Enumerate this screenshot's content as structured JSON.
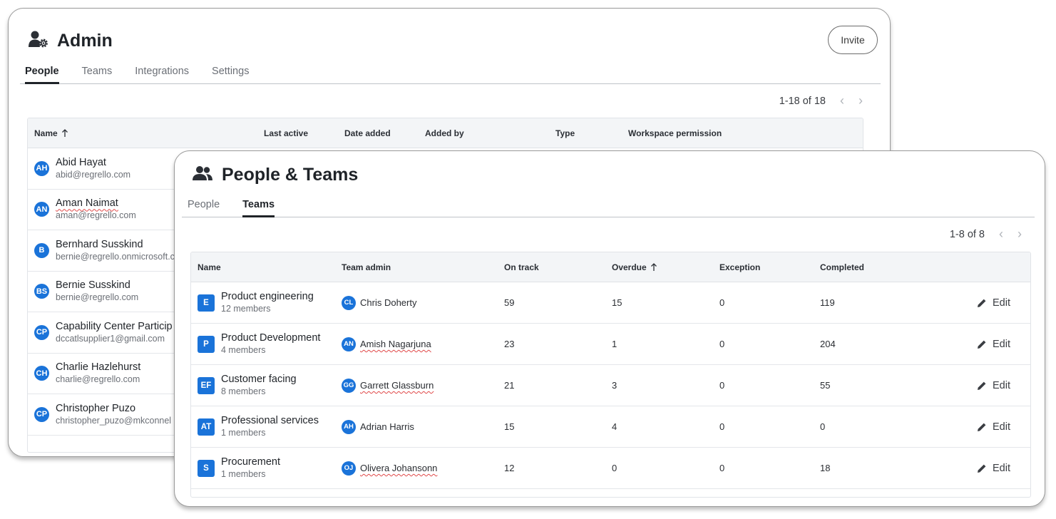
{
  "admin": {
    "title": "Admin",
    "invite_label": "Invite",
    "tabs": [
      {
        "label": "People",
        "active": true
      },
      {
        "label": "Teams",
        "active": false
      },
      {
        "label": "Integrations",
        "active": false
      },
      {
        "label": "Settings",
        "active": false
      }
    ],
    "pagination": "1-18 of 18",
    "columns": [
      "Name",
      "Last active",
      "Date added",
      "Added by",
      "Type",
      "Workspace permission"
    ],
    "sort_column": "Name",
    "rows": [
      {
        "initials": "AH",
        "name": "Abid Hayat",
        "email": "abid@regrello.com"
      },
      {
        "initials": "AN",
        "name": "Aman Naimat",
        "email": "aman@regrello.com"
      },
      {
        "initials": "B",
        "name": "Bernhard Susskind",
        "email": "bernie@regrello.onmicrosoft.c"
      },
      {
        "initials": "BS",
        "name": "Bernie Susskind",
        "email": "bernie@regrello.com"
      },
      {
        "initials": "CP",
        "name": "Capability Center Particip",
        "email": "dccatlsupplier1@gmail.com"
      },
      {
        "initials": "CH",
        "name": "Charlie Hazlehurst",
        "email": "charlie@regrello.com"
      },
      {
        "initials": "CP",
        "name": "Christopher Puzo",
        "email": "christopher_puzo@mkconnel"
      }
    ]
  },
  "people_teams": {
    "title": "People & Teams",
    "tabs": [
      {
        "label": "People",
        "active": false
      },
      {
        "label": "Teams",
        "active": true
      }
    ],
    "pagination": "1-8 of 8",
    "columns": [
      "Name",
      "Team admin",
      "On track",
      "Overdue",
      "Exception",
      "Completed"
    ],
    "sort_column": "Overdue",
    "edit_label": "Edit",
    "rows": [
      {
        "badge": "E",
        "name": "Product engineering",
        "members": "12 members",
        "admin_initials": "CL",
        "admin": "Chris Doherty",
        "on_track": "59",
        "overdue": "15",
        "exception": "0",
        "completed": "119"
      },
      {
        "badge": "P",
        "name": "Product Development",
        "members": "4 members",
        "admin_initials": "AN",
        "admin": "Amish Nagarjuna",
        "on_track": "23",
        "overdue": "1",
        "exception": "0",
        "completed": "204"
      },
      {
        "badge": "EF",
        "name": "Customer facing",
        "members": "8 members",
        "admin_initials": "GG",
        "admin": "Garrett Glassburn",
        "on_track": "21",
        "overdue": "3",
        "exception": "0",
        "completed": "55"
      },
      {
        "badge": "AT",
        "name": "Professional services",
        "members": "1 members",
        "admin_initials": "AH",
        "admin": "Adrian Harris",
        "on_track": "15",
        "overdue": "4",
        "exception": "0",
        "completed": "0"
      },
      {
        "badge": "S",
        "name": "Procurement",
        "members": "1 members",
        "admin_initials": "OJ",
        "admin": "Olivera Johansonn",
        "on_track": "12",
        "overdue": "0",
        "exception": "0",
        "completed": "18"
      }
    ]
  },
  "colors": {
    "accent": "#1a73d9",
    "text": "#1f2328",
    "muted": "#6b6f76",
    "header_bg": "#f3f5f7"
  },
  "icons": {
    "admin": "user-gear-icon",
    "people_teams": "users-icon",
    "sort": "arrow-up-icon",
    "edit": "pencil-icon",
    "prev": "chevron-left-icon",
    "next": "chevron-right-icon"
  }
}
